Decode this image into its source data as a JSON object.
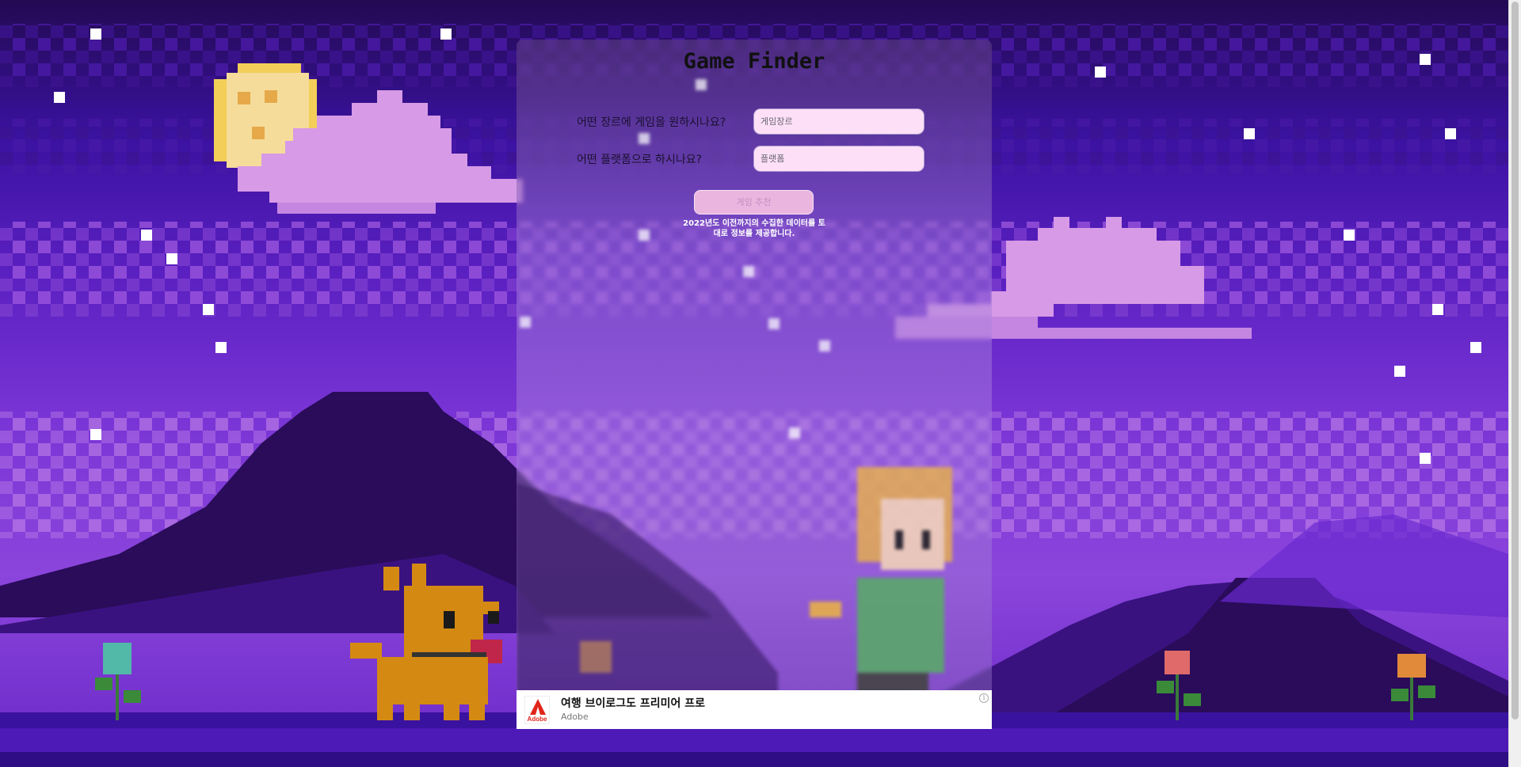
{
  "app": {
    "title": "Game Finder"
  },
  "form": {
    "genre_question": "어떤 장르에 게임을 원하시나요?",
    "genre_placeholder": "게임장르",
    "genre_value": "",
    "platform_question": "어떤 플랫폼으로 하시나요?",
    "platform_placeholder": "플랫폼",
    "platform_value": "",
    "submit_label": "게임 추천",
    "note": "2022년도 이전까지의 수집한 데이터를 토대로 정보를 제공합니다."
  },
  "ad": {
    "title": "여행 브이로그도 프리미어 프로",
    "advertiser": "Adobe",
    "logo_text": "Adobe",
    "info_glyph": "i"
  },
  "colors": {
    "sky_top": "#230a52",
    "sky_mid": "#4a17b0",
    "sky_low": "#7a2fd6",
    "cloud": "#d79ae6",
    "mountain": "#2a0c5a",
    "panel_input": "#fde0f7",
    "button": "#eab6e0",
    "moon": "#f3cf5a",
    "dog": "#d48a12"
  },
  "icons": {
    "info": "info-icon",
    "adobe": "adobe-logo-icon"
  }
}
